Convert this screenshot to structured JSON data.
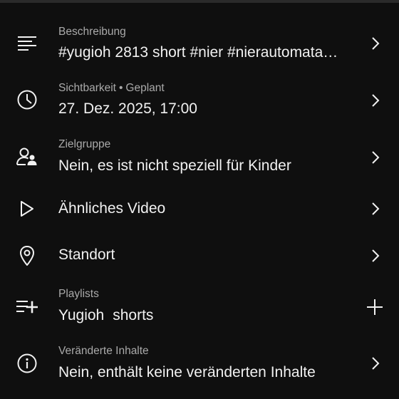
{
  "rows": {
    "description": {
      "icon": "description-lines-icon",
      "label": "Beschreibung",
      "value": "#yugioh 2813 short #nier #nierautomata…",
      "action_icon": "chevron-right-icon"
    },
    "visibility": {
      "icon": "clock-icon",
      "label_main": "Sichtbarkeit",
      "label_separator": "•",
      "label_status": "Geplant",
      "value": "27. Dez. 2025, 17:00",
      "action_icon": "chevron-right-icon"
    },
    "audience": {
      "icon": "audience-person-icon",
      "label": "Zielgruppe",
      "value": "Nein, es ist nicht speziell für Kinder",
      "action_icon": "chevron-right-icon"
    },
    "related_video": {
      "icon": "play-icon",
      "value": "Ähnliches Video",
      "action_icon": "chevron-right-icon"
    },
    "location": {
      "icon": "location-pin-icon",
      "value": "Standort",
      "action_icon": "chevron-right-icon"
    },
    "playlists": {
      "icon": "playlist-add-icon",
      "label": "Playlists",
      "items": [
        "Yugioh",
        "shorts"
      ],
      "action_icon": "plus-icon"
    },
    "altered_content": {
      "icon": "info-icon",
      "label": "Veränderte Inhalte",
      "value": "Nein, enthält keine veränderten Inhalte",
      "action_icon": "chevron-right-icon"
    }
  },
  "colors": {
    "background": "#0f0f0f",
    "primary_text": "#f1f1f1",
    "secondary_text": "#aaaaaa"
  }
}
